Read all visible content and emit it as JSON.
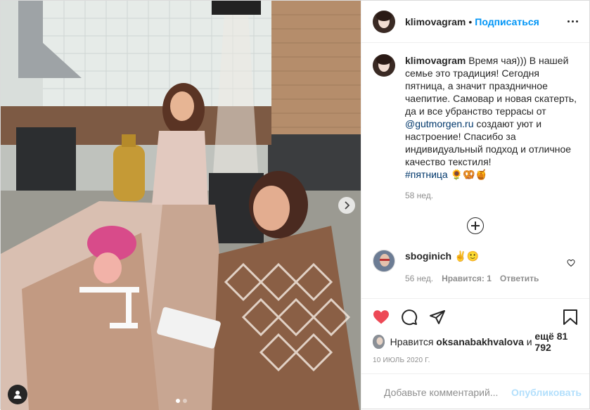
{
  "post": {
    "author": {
      "username": "klimovagram",
      "follow_label": "Подписаться",
      "separator": "•"
    },
    "caption": {
      "username": "klimovagram",
      "text_part1": "Время чая))) В нашей семье это традиция! Сегодня пятница, а значит праздничное чаепитие. Самовар и новая скатерть, да и все убранство террасы от ",
      "mention": "@gutmorgen.ru",
      "text_part2": " создают уют и настроение! Спасибо за индивидуальный подход и отличное качество текстиля!",
      "hashtag": "#пятница",
      "emojis": "🌻🥨🍯",
      "time": "58 нед."
    },
    "comments": [
      {
        "username": "sboginich",
        "text": "✌️🙂",
        "time": "56 нед.",
        "likes_label": "Нравится: 1",
        "reply_label": "Ответить"
      }
    ],
    "likes": {
      "prefix": "Нравится",
      "liked_by": "oksanabakhvalova",
      "connector": "и",
      "others": "ещё 81 792"
    },
    "date": "10 ИЮЛЬ 2020 Г.",
    "add_comment": {
      "placeholder": "Добавьте комментарий...",
      "publish_label": "Опубликовать"
    },
    "carousel": {
      "current": 1,
      "total": 2
    }
  },
  "colors": {
    "link_blue": "#0095f6",
    "heart_red": "#ed4956",
    "publish_disabled": "#b2dffc",
    "muted": "#8e8e8e"
  },
  "icons": [
    "more-icon",
    "heart-icon",
    "comment-icon",
    "share-icon",
    "bookmark-icon",
    "emoji-icon",
    "plus-circle-icon",
    "chevron-right-icon",
    "user-tag-icon"
  ]
}
